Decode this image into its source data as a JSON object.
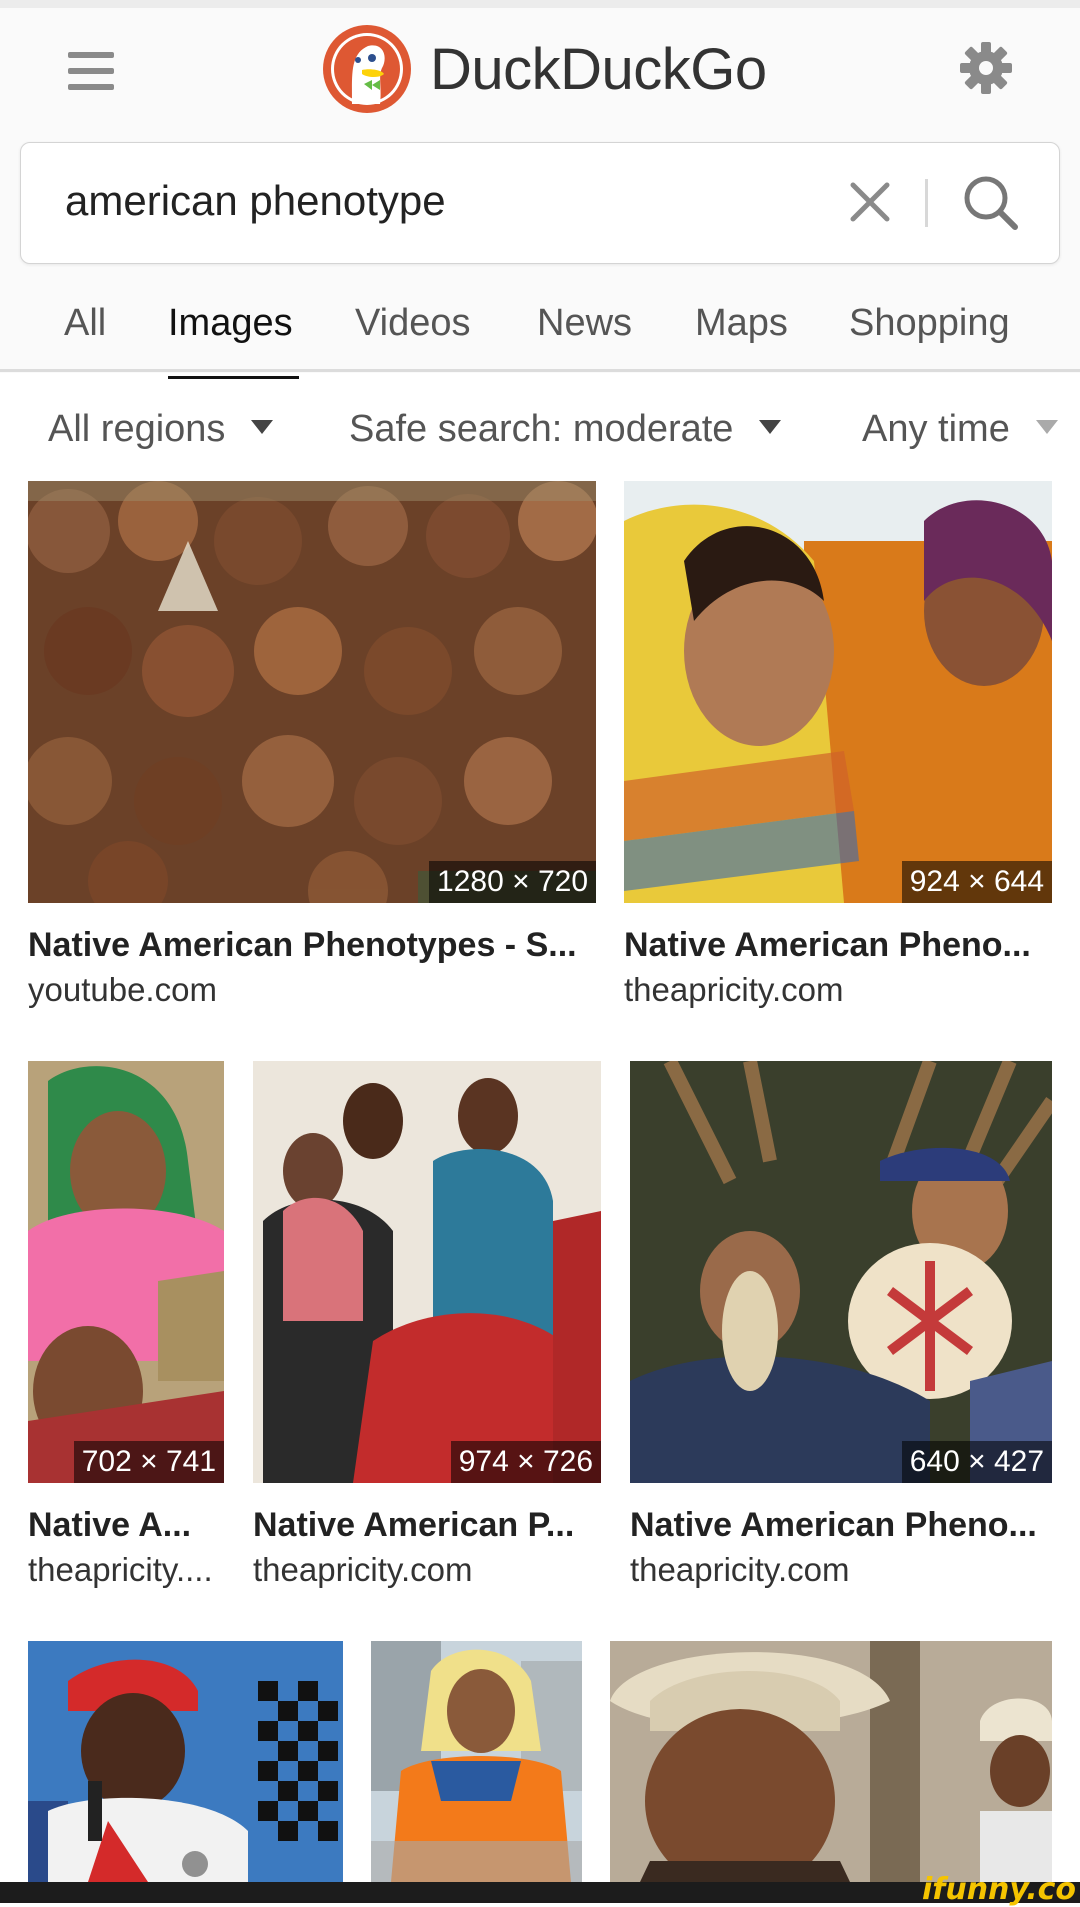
{
  "header": {
    "app_title": "DuckDuckGo",
    "menu_icon": "hamburger-menu-icon",
    "settings_icon": "gear-icon"
  },
  "search": {
    "query": "american phenotype",
    "clear_icon": "close-icon",
    "search_icon": "search-icon"
  },
  "tabs": [
    {
      "label": "All",
      "active": false
    },
    {
      "label": "Images",
      "active": true
    },
    {
      "label": "Videos",
      "active": false
    },
    {
      "label": "News",
      "active": false
    },
    {
      "label": "Maps",
      "active": false
    },
    {
      "label": "Shopping",
      "active": false
    }
  ],
  "filters": {
    "region": "All regions",
    "safe_search": "Safe search: moderate",
    "time": "Any time"
  },
  "results": [
    {
      "title": "Native American Phenotypes - S...",
      "source": "youtube.com",
      "dimensions": "1280 × 720"
    },
    {
      "title": "Native American Pheno...",
      "source": "theapricity.com",
      "dimensions": "924 × 644"
    },
    {
      "title": "Native A...",
      "source": "theapricity....",
      "dimensions": "702 × 741"
    },
    {
      "title": "Native American P...",
      "source": "theapricity.com",
      "dimensions": "974 × 726"
    },
    {
      "title": "Native American Pheno...",
      "source": "theapricity.com",
      "dimensions": "640 × 427"
    }
  ],
  "watermark": "ifunny.co",
  "colors": {
    "logo_orange": "#de5833",
    "header_bg": "#fafafa",
    "watermark": "#f5c400"
  }
}
